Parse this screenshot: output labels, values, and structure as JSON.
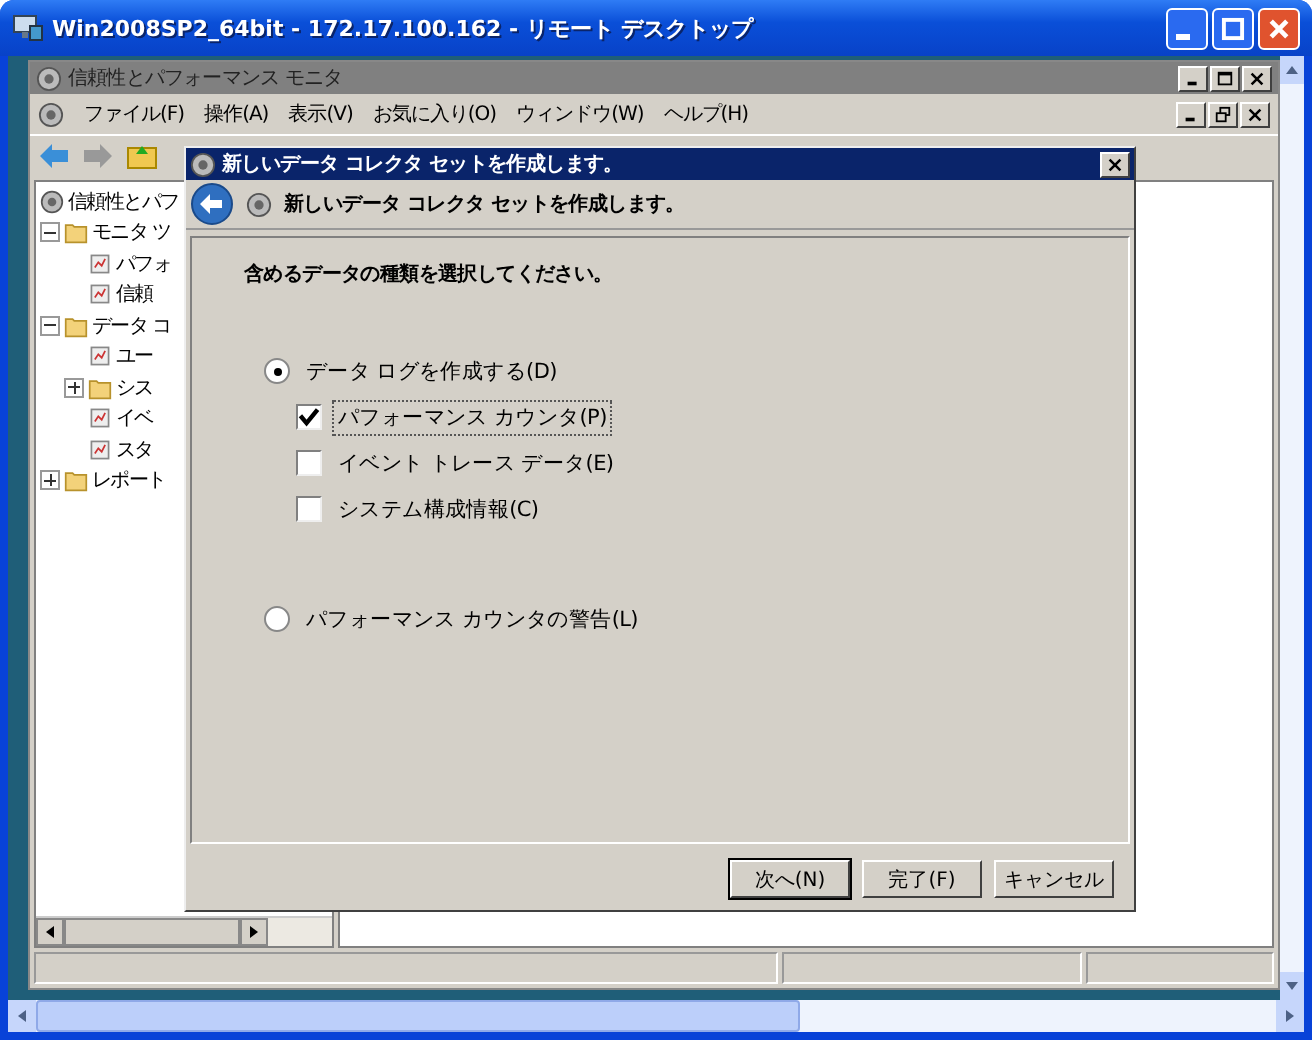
{
  "window": {
    "title": "Win2008SP2_64bit - 172.17.100.162 - リモート デスクトップ"
  },
  "mmc": {
    "title": "信頼性とパフォーマンス モニタ",
    "menu": [
      "ファイル(F)",
      "操作(A)",
      "表示(V)",
      "お気に入り(O)",
      "ウィンドウ(W)",
      "ヘルプ(H)"
    ],
    "tree": [
      {
        "label": "信頼性とパフ",
        "children": [
          {
            "label": "モニタ ツ",
            "expanded": true,
            "children": [
              {
                "label": "パフォ"
              },
              {
                "label": "信頼"
              }
            ]
          },
          {
            "label": "データ コ",
            "expanded": true,
            "children": [
              {
                "label": "ユー"
              },
              {
                "label": "シス",
                "expanded": false
              },
              {
                "label": "イベ"
              },
              {
                "label": "スタ"
              }
            ]
          },
          {
            "label": "レポート",
            "expanded": false
          }
        ]
      }
    ]
  },
  "dialog": {
    "title": "新しいデータ コレクタ セットを作成します。",
    "heading": "新しいデータ コレクタ セットを作成します。",
    "prompt": "含めるデータの種類を選択してください。",
    "options": [
      {
        "kind": "radio",
        "label": "データ ログを作成する(D)",
        "selected": true
      },
      {
        "kind": "checkbox",
        "label": "パフォーマンス カウンタ(P)",
        "checked": true,
        "focused": true
      },
      {
        "kind": "checkbox",
        "label": "イベント トレース データ(E)",
        "checked": false,
        "focused": false
      },
      {
        "kind": "checkbox",
        "label": "システム構成情報(C)",
        "checked": false,
        "focused": false
      },
      {
        "kind": "radio",
        "label": "パフォーマンス カウンタの警告(L)",
        "selected": false
      }
    ],
    "buttons": [
      {
        "label": "次へ(N)",
        "default": true
      },
      {
        "label": "完了(F)",
        "default": false
      },
      {
        "label": "キャンセル",
        "default": false
      }
    ]
  }
}
